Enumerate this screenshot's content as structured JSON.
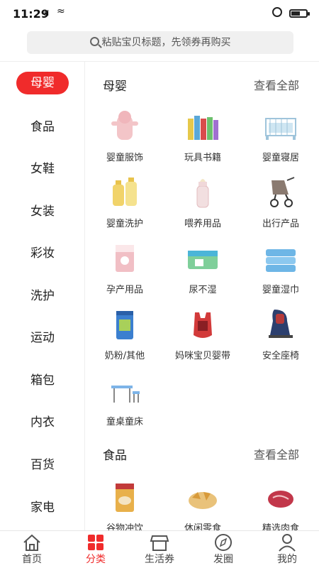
{
  "status": {
    "time": "11:29",
    "signal": "ııl",
    "wifi": "≈"
  },
  "search": {
    "placeholder": "粘贴宝贝标题，先领券再购买"
  },
  "sidebar": {
    "items": [
      {
        "label": "母婴",
        "active": true
      },
      {
        "label": "食品"
      },
      {
        "label": "女鞋"
      },
      {
        "label": "女装"
      },
      {
        "label": "彩妆"
      },
      {
        "label": "洗护"
      },
      {
        "label": "运动"
      },
      {
        "label": "箱包"
      },
      {
        "label": "内衣"
      },
      {
        "label": "百货"
      },
      {
        "label": "家电"
      }
    ]
  },
  "sections": [
    {
      "title": "母婴",
      "more": "查看全部",
      "items": [
        {
          "label": "婴童服饰",
          "icon": "baby-clothes-icon",
          "color": "#f3c5c8"
        },
        {
          "label": "玩具书籍",
          "icon": "toys-books-icon",
          "color": "#e6c84a"
        },
        {
          "label": "婴童寝居",
          "icon": "baby-crib-icon",
          "color": "#cfe6f2"
        },
        {
          "label": "婴童洗护",
          "icon": "baby-wash-icon",
          "color": "#f1d36a"
        },
        {
          "label": "喂养用品",
          "icon": "baby-bottle-icon",
          "color": "#f2dfe0"
        },
        {
          "label": "出行产品",
          "icon": "stroller-icon",
          "color": "#8a7a70"
        },
        {
          "label": "孕产用品",
          "icon": "maternity-icon",
          "color": "#f1bfc5"
        },
        {
          "label": "尿不湿",
          "icon": "diaper-icon",
          "color": "#7fcf9a"
        },
        {
          "label": "婴童湿巾",
          "icon": "wet-wipes-icon",
          "color": "#6eb6e6"
        },
        {
          "label": "奶粉/其他",
          "icon": "milk-powder-icon",
          "color": "#3b7fcf"
        },
        {
          "label": "妈咪宝贝婴带",
          "icon": "baby-carrier-icon",
          "color": "#d23a3a"
        },
        {
          "label": "安全座椅",
          "icon": "car-seat-icon",
          "color": "#2c3f6e"
        },
        {
          "label": "童桌童床",
          "icon": "kids-desk-icon",
          "color": "#7db4e8"
        }
      ]
    },
    {
      "title": "食品",
      "more": "查看全部",
      "items": [
        {
          "label": "谷物冲饮",
          "icon": "cereal-drink-icon",
          "color": "#e8b04a"
        },
        {
          "label": "休闲零食",
          "icon": "snacks-icon",
          "color": "#e9c27a"
        },
        {
          "label": "精选肉食",
          "icon": "meat-icon",
          "color": "#c2374a"
        }
      ]
    }
  ],
  "bottom_nav": {
    "items": [
      {
        "label": "首页",
        "icon": "home-icon"
      },
      {
        "label": "分类",
        "icon": "category-icon",
        "active": true
      },
      {
        "label": "生活券",
        "icon": "shop-icon"
      },
      {
        "label": "发圈",
        "icon": "compass-icon"
      },
      {
        "label": "我的",
        "icon": "profile-icon"
      }
    ]
  },
  "colors": {
    "accent": "#f02b2b"
  }
}
